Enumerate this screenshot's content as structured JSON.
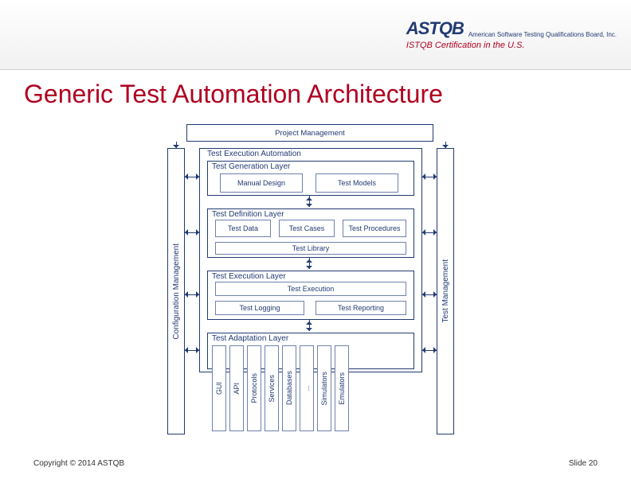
{
  "header": {
    "logo_text": "ASTQB",
    "logo_sub": "American Software Testing Qualifications Board, Inc.",
    "tagline": "ISTQB Certification in the U.S."
  },
  "title": "Generic Test Automation Architecture",
  "footer": {
    "copyright": "Copyright © 2014 ASTQB",
    "slide": "Slide 20"
  },
  "diagram": {
    "project_management": "Project Management",
    "config_mgmt": "Configuration Management",
    "test_mgmt": "Test Management",
    "tea_title": "Test Execution Automation",
    "generation_layer": {
      "label": "Test Generation Layer",
      "boxes": [
        "Manual Design",
        "Test Models"
      ]
    },
    "definition_layer": {
      "label": "Test Definition Layer",
      "row1": [
        "Test Data",
        "Test Cases",
        "Test Procedures"
      ],
      "library": "Test Library"
    },
    "execution_layer": {
      "label": "Test Execution Layer",
      "exec": "Test Execution",
      "row2": [
        "Test Logging",
        "Test Reporting"
      ]
    },
    "adaptation_layer": {
      "label": "Test Adaptation Layer",
      "cols": [
        "GUI",
        "API",
        "Protocols",
        "Services",
        "Databases",
        "...",
        "Simulators",
        "Emulators"
      ]
    }
  }
}
